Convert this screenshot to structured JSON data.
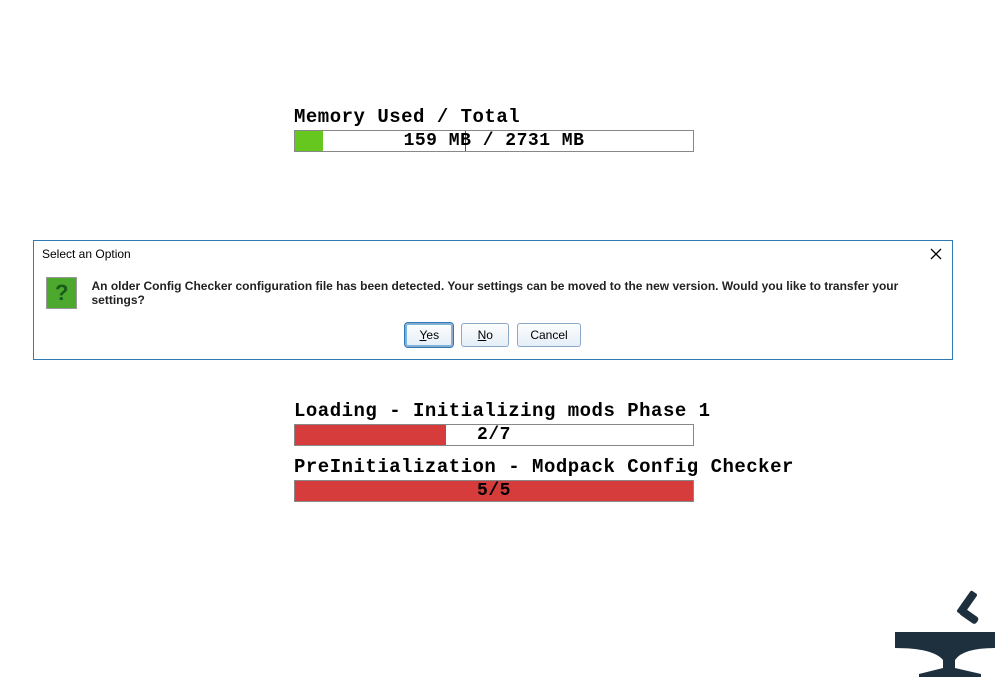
{
  "memory": {
    "label": "Memory Used / Total",
    "text": "159 MB / 2731 MB",
    "used_mb": 159,
    "total_mb": 2731,
    "fill_percent": 7
  },
  "dialog": {
    "title": "Select an Option",
    "icon": "question-icon",
    "icon_char": "?",
    "message": "An older Config Checker configuration file has been detected. Your settings can be moved to the new version. Would you like to transfer your settings?",
    "buttons": {
      "yes": {
        "label": "Yes",
        "mnemonic": "Y"
      },
      "no": {
        "label": "No",
        "mnemonic": "N"
      },
      "cancel": {
        "label": "Cancel"
      }
    }
  },
  "loading": {
    "phase1": {
      "label": "Loading - Initializing mods Phase 1",
      "progress_text": "2/7",
      "current": 2,
      "total": 7,
      "fill_percent": 38
    },
    "preinit": {
      "label": "PreInitialization - Modpack Config Checker",
      "progress_text": "5/5",
      "current": 5,
      "total": 5,
      "fill_percent": 100
    }
  },
  "colors": {
    "memory_bar_fill": "#66c81e",
    "progress_bar_fill": "#d73c3c",
    "dialog_border": "#2e7bb8"
  }
}
